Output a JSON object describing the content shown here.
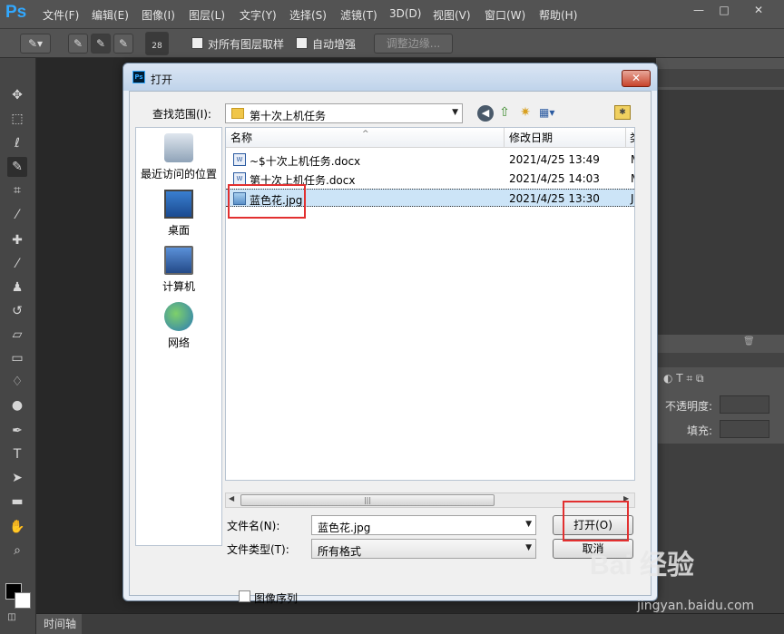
{
  "app": {
    "logo": "Ps"
  },
  "menubar": {
    "items": [
      "文件(F)",
      "编辑(E)",
      "图像(I)",
      "图层(L)",
      "文字(Y)",
      "选择(S)",
      "滤镜(T)",
      "3D(D)",
      "视图(V)",
      "窗口(W)",
      "帮助(H)"
    ],
    "window_buttons": [
      "—",
      "□",
      "✕"
    ]
  },
  "options": {
    "brush_size": "28",
    "sample_all_layers": "对所有图层取样",
    "auto_enhance": "自动增强",
    "refine_edge": "调整边缘..."
  },
  "right_panel": {
    "opacity_label": "不透明度:",
    "fill_label": "填充:"
  },
  "timeline": {
    "label": "时间轴"
  },
  "dialog": {
    "title": "打开",
    "close": "✕",
    "look_in_label": "查找范围(I):",
    "look_in_value": "第十次上机任务",
    "places": [
      "最近访问的位置",
      "桌面",
      "计算机",
      "网络"
    ],
    "columns": [
      "名称",
      "修改日期",
      "类"
    ],
    "files": [
      {
        "name": "~$十次上机任务.docx",
        "date": "2021/4/25 13:49",
        "extra": "M",
        "icon": "word-doc-icon"
      },
      {
        "name": "第十次上机任务.docx",
        "date": "2021/4/25 14:03",
        "extra": "M",
        "icon": "word-doc-icon"
      },
      {
        "name": "蓝色花.jpg",
        "date": "2021/4/25 13:30",
        "extra": "J",
        "icon": "jpg-image-icon",
        "selected": true
      }
    ],
    "filename_label": "文件名(N):",
    "filename_value": "蓝色花.jpg",
    "filetype_label": "文件类型(T):",
    "filetype_value": "所有格式",
    "open_button": "打开(O)",
    "cancel_button": "取消",
    "image_sequence": "图像序列"
  },
  "watermark": {
    "brand": "Bai 经验",
    "url": "jingyan.baidu.com"
  },
  "colors": {
    "highlight": "#e23030",
    "selection": "#cce4f7",
    "ps_blue": "#31a8ff"
  }
}
